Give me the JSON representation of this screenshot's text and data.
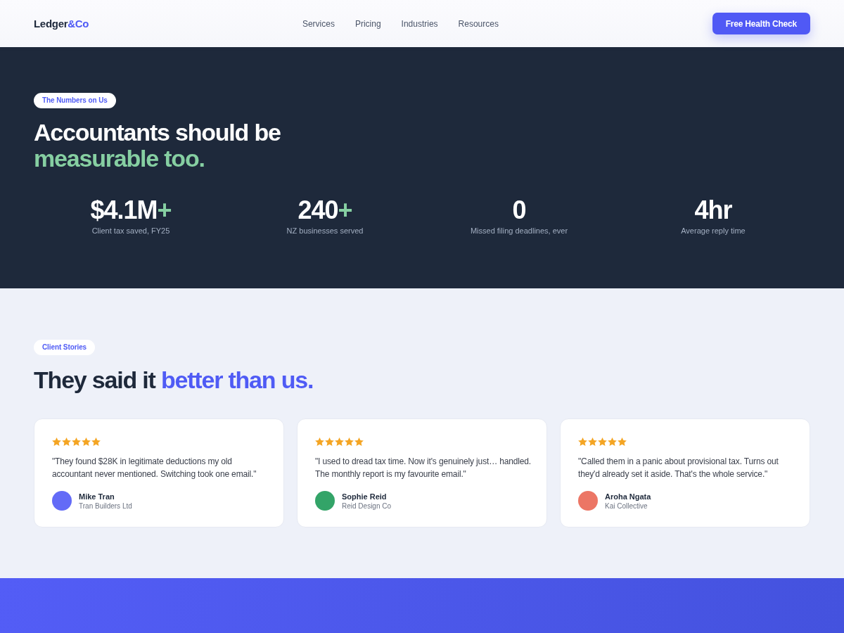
{
  "header": {
    "logo": {
      "text": "Ledger",
      "accent": "&Co"
    },
    "nav": [
      "Services",
      "Pricing",
      "Industries",
      "Resources"
    ],
    "cta": "Free Health Check"
  },
  "stats_section": {
    "badge": "The Numbers on Us",
    "heading": {
      "text": "Accountants should be",
      "highlight": "measurable too."
    },
    "stats": [
      {
        "value": "$4.1M",
        "suffix": "+",
        "label": "Client tax saved, FY25"
      },
      {
        "value": "240",
        "suffix": "+",
        "label": "NZ businesses served"
      },
      {
        "value": "0",
        "label": "Missed filing deadlines, ever"
      },
      {
        "value": "4hr",
        "label": "Average reply time"
      }
    ]
  },
  "testimonials_section": {
    "badge": "Client Stories",
    "heading": {
      "text": "They said it",
      "highlight": "better than us."
    },
    "testimonials": [
      {
        "stars": 5,
        "quote": "\"They found $28K in legitimate deductions my old accountant never mentioned. Switching took one email.\"",
        "name": "Mike Tran",
        "company": "Tran Builders Ltd",
        "color": "#636bf7"
      },
      {
        "stars": 5,
        "quote": "\"I used to dread tax time. Now it's genuinely just… handled. The monthly report is my favourite email.\"",
        "name": "Sophie Reid",
        "company": "Reid Design Co",
        "color": "#33a468"
      },
      {
        "stars": 5,
        "quote": "\"Called them in a panic about provisional tax. Turns out they'd already set it aside. That's the whole service.\"",
        "name": "Aroha Ngata",
        "company": "Kai Collective",
        "color": "#ec7665"
      }
    ]
  }
}
